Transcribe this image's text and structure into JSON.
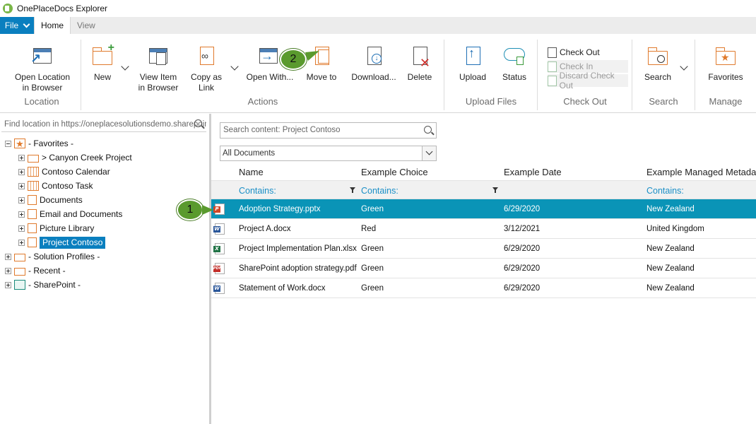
{
  "window": {
    "title": "OnePlaceDocs Explorer"
  },
  "tabs": {
    "file": "File",
    "home": "Home",
    "view": "View"
  },
  "ribbon": {
    "location": {
      "label": "Location",
      "open_location": "Open Location\nin Browser"
    },
    "actions": {
      "label": "Actions",
      "new": "New",
      "view_item": "View Item\nin Browser",
      "copy_link": "Copy as\nLink",
      "open_with": "Open With...",
      "move_to": "Move to",
      "download": "Download...",
      "delete": "Delete"
    },
    "upload": {
      "label": "Upload Files",
      "upload": "Upload",
      "status": "Status"
    },
    "checkout": {
      "label": "Check Out",
      "check_out": "Check Out",
      "check_in": "Check In",
      "discard": "Discard Check Out"
    },
    "search": {
      "label": "Search",
      "search": "Search"
    },
    "manage": {
      "label": "Manage",
      "favorites": "Favorites"
    }
  },
  "left": {
    "find_placeholder": "Find location in https://oneplacesolutionsdemo.sharepoint",
    "tree": {
      "favorites": "- Favorites -",
      "canyon": "> Canyon Creek Project",
      "calendar": "Contoso Calendar",
      "task": "Contoso Task",
      "documents": "Documents",
      "email_docs": "Email and Documents",
      "picture_library": "Picture Library",
      "project_contoso": "Project Contoso",
      "solution_profiles": "- Solution Profiles -",
      "recent": "- Recent -",
      "sharepoint": "- SharePoint -"
    }
  },
  "right": {
    "search_placeholder": "Search content: Project Contoso",
    "view_selected": "All Documents",
    "columns": [
      "Name",
      "Example Choice",
      "Example Date",
      "Example Managed Metada"
    ],
    "filter_text": "Contains:",
    "rows": [
      {
        "icon": "powerpoint",
        "name": "Adoption Strategy.pptx",
        "choice": "Green",
        "date": "6/29/2020",
        "managed": "New Zealand"
      },
      {
        "icon": "word",
        "name": "Project A.docx",
        "choice": "Red",
        "date": "3/12/2021",
        "managed": "United Kingdom"
      },
      {
        "icon": "excel",
        "name": "Project Implementation Plan.xlsx",
        "choice": "Green",
        "date": "6/29/2020",
        "managed": "New Zealand"
      },
      {
        "icon": "pdf",
        "name": "SharePoint adoption strategy.pdf",
        "choice": "Green",
        "date": "6/29/2020",
        "managed": "New Zealand"
      },
      {
        "icon": "word",
        "name": "Statement of Work.docx",
        "choice": "Green",
        "date": "6/29/2020",
        "managed": "New Zealand"
      }
    ]
  },
  "callouts": {
    "one": "1",
    "two": "2"
  },
  "colors": {
    "accent": "#0a7fbf",
    "selected_row": "#0a94b7",
    "callout": "#5a9a2e"
  }
}
